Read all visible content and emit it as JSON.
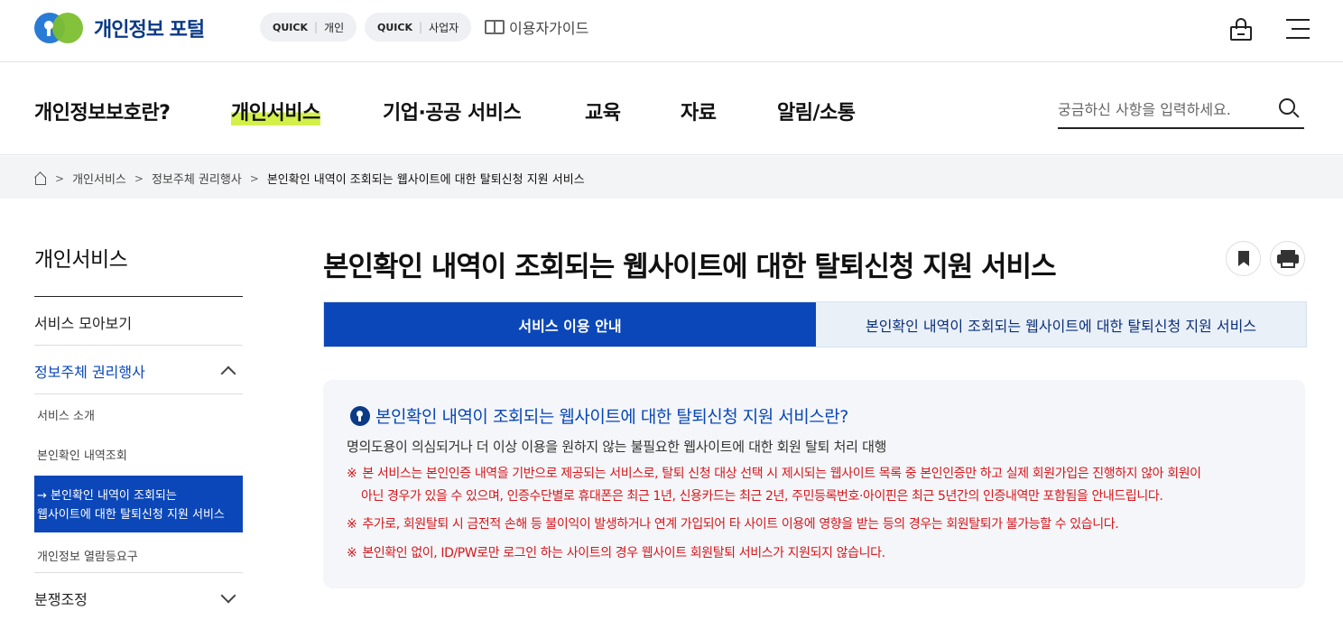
{
  "header": {
    "logo_text": "개인정보 포털",
    "quick_personal": {
      "tag": "QUICK",
      "label": "개인"
    },
    "quick_business": {
      "tag": "QUICK",
      "label": "사업자"
    },
    "guide_label": "이용자가이드",
    "icons": [
      "lock-icon",
      "hamburger-menu-icon",
      "guide-book-icon"
    ]
  },
  "gnb": {
    "items": [
      "개인정보보호란?",
      "개인서비스",
      "기업·공공 서비스",
      "교육",
      "자료",
      "알림/소통"
    ],
    "active_index": 1,
    "search_placeholder": "궁금하신 사항을 입력하세요."
  },
  "breadcrumb": {
    "items": [
      "개인서비스",
      "정보주체 권리행사",
      "본인확인 내역이 조회되는 웹사이트에 대한 탈퇴신청 지원 서비스"
    ]
  },
  "lnb": {
    "title": "개인서비스",
    "items": {
      "service_all": "서비스 모아보기",
      "rights": "정보주체 권리행사",
      "intro": "서비스 소개",
      "history": "본인확인 내역조회",
      "active_line1": "→ 본인확인 내역이 조회되는",
      "active_line2": "웹사이트에 대한 탈퇴신청 지원 서비스",
      "view_request": "개인정보 열람등요구",
      "dispute": "분쟁조정"
    }
  },
  "main": {
    "title": "본인확인 내역이 조회되는 웹사이트에 대한 탈퇴신청 지원 서비스",
    "tabs": [
      "서비스 이용 안내",
      "본인확인 내역이 조회되는 웹사이트에 대한 탈퇴신청 지원 서비스"
    ],
    "info": {
      "title": "본인확인 내역이 조회되는 웹사이트에 대한 탈퇴신청 지원 서비스란?",
      "desc": "명의도용이 의심되거나 더 이상 이용을 원하지 않는 불필요한 웹사이트에 대한 회원 탈퇴 처리 대행",
      "mark": "※",
      "note1_line1": "본 서비스는 본인인증 내역을 기반으로 제공되는 서비스로, 탈퇴 신청 대상 선택 시 제시되는 웹사이트 목록 중 본인인증만 하고 실제 회원가입은 진행하지 않아 회원이",
      "note1_line2": "아닌 경우가 있을 수 있으며, 인증수단별로 휴대폰은 최근 1년, 신용카드는 최근 2년, 주민등록번호·아이핀은 최근 5년간의 인증내역만 포함됨을 안내드립니다.",
      "note2": "추가로, 회원탈퇴 시 금전적 손해 등 불이익이 발생하거나 연계 가입되어 타 사이트 이용에 영향을 받는 등의 경우는 회원탈퇴가 불가능할 수 있습니다.",
      "note3": "본인확인 없이, ID/PW로만 로그인 하는 사이트의 경우 웹사이트 회원탈퇴 서비스가 지원되지 않습니다."
    }
  },
  "colors": {
    "primary": "#0b47b8",
    "highlight": "#d3f04a",
    "warning": "#d6161b"
  }
}
